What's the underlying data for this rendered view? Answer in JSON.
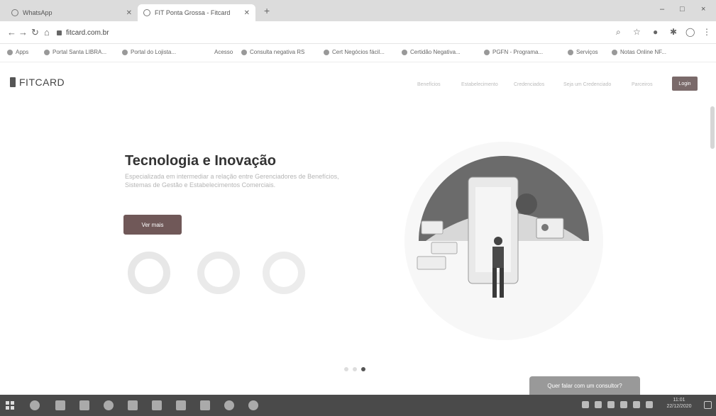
{
  "browser": {
    "tabs": [
      {
        "title": "WhatsApp",
        "active": false
      },
      {
        "title": "FIT Ponta Grossa - Fitcard",
        "active": true
      }
    ],
    "new_tab_symbol": "+",
    "url": "fitcard.com.br",
    "window_controls": {
      "minimize": "–",
      "maximize": "□",
      "close": "×"
    },
    "bookmarks": [
      "Apps",
      "Portal Santa LIBRA...",
      "Portal do Lojista...",
      "Acesso",
      "Consulta negativa RS",
      "Cert Negócios fácil...",
      "Certidão Negativa...",
      "PGFN - Programa...",
      "Serviços",
      "Notas Online NF..."
    ]
  },
  "site": {
    "logo_text": "FITCARD",
    "nav": [
      "Benefícios",
      "Estabelecimento",
      "Credenciados",
      "Seja um Credenciado",
      "Parceiros"
    ],
    "login_label": "Login",
    "hero": {
      "title": "Tecnologia e Inovação",
      "description": "Especializada em intermediar a relação entre Gerenciadores de Benefícios, Sistemas de Gestão e Estabelecimentos Comerciais.",
      "cta_label": "Ver mais"
    },
    "carousel": {
      "slides": 3,
      "active_index": 2
    },
    "help_label": "Quer falar com um consultor?"
  },
  "taskbar": {
    "time": "11:01",
    "date": "22/12/2020"
  },
  "colors": {
    "accent": "#705858",
    "taskbar": "#4a4a4a"
  }
}
